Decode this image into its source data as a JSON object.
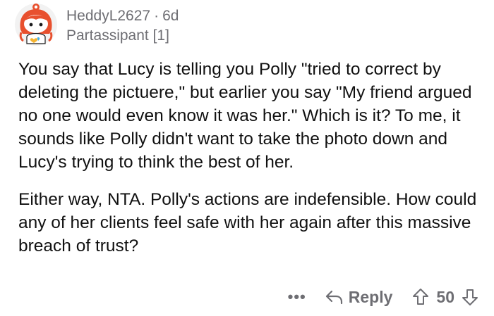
{
  "comment": {
    "author": "HeddyL2627",
    "separator": "·",
    "age": "6d",
    "flair": "Partassipant [1]",
    "paragraphs": [
      "You say that Lucy is telling you Polly \"tried to correct by deleting the pictuere,\" but earlier you say \"My friend argued no one would even know it was her.\" Which is it? To me, it sounds like Polly didn't want to take the photo down and Lucy's trying to think the best of her.",
      "Either way, NTA. Polly's actions are indefensible. How could any of her clients feel safe with her again after this massive breach of trust?"
    ],
    "actions": {
      "more_label": "•••",
      "reply_label": "Reply",
      "score": "50"
    }
  },
  "icons": {
    "avatar": "snoo-avatar-red-hair",
    "reply": "reply-arrow-icon",
    "upvote": "upvote-arrow-icon",
    "downvote": "downvote-arrow-icon",
    "more": "more-options-icon"
  },
  "colors": {
    "text": "#111111",
    "muted": "#6e6e73",
    "avatar_hair": "#e8502e",
    "background": "#ffffff"
  }
}
